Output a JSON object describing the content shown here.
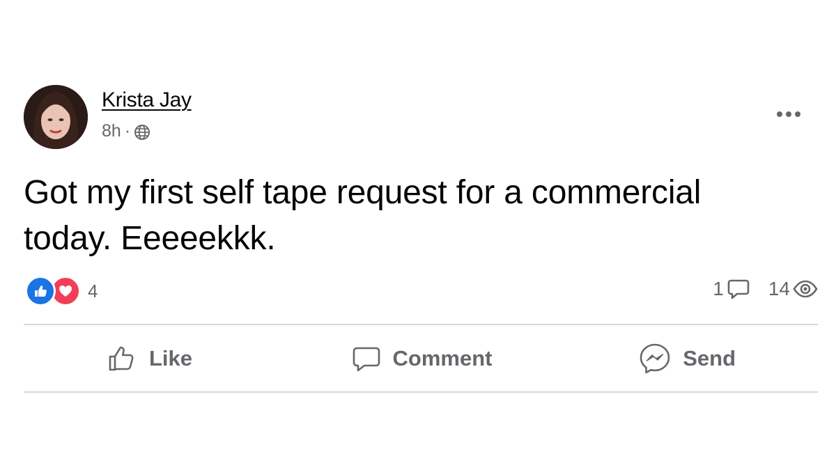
{
  "post": {
    "author": {
      "name": "Krista Jay",
      "avatar_icon": "profile-photo"
    },
    "timestamp": "8h",
    "separator": "·",
    "audience_icon": "globe-icon",
    "text": "Got my first self tape request for a commercial today. Eeeeekkk.",
    "more_icon": "ellipsis-icon"
  },
  "reactions": {
    "types": [
      "like",
      "love"
    ],
    "count": "4"
  },
  "stats": {
    "comments": "1",
    "views": "14"
  },
  "actions": {
    "like_label": "Like",
    "comment_label": "Comment",
    "send_label": "Send"
  },
  "colors": {
    "like_blue": "#1b74e4",
    "love_red": "#f33e58",
    "secondary_text": "#65676b",
    "primary_text": "#050505",
    "divider": "#d5d7da"
  }
}
